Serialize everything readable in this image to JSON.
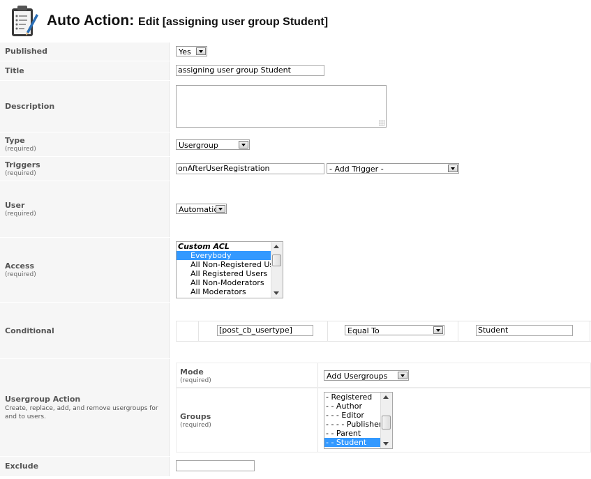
{
  "header": {
    "title": "Auto Action:",
    "subtitle": "Edit [assigning user group Student]",
    "icon": "clipboard-pencil-icon"
  },
  "fields": {
    "published": {
      "label": "Published",
      "value": "Yes"
    },
    "title": {
      "label": "Title",
      "value": "assigning user group Student"
    },
    "description": {
      "label": "Description",
      "value": ""
    },
    "type": {
      "label": "Type",
      "required": "(required)",
      "value": "Usergroup"
    },
    "triggers": {
      "label": "Triggers",
      "required": "(required)",
      "value": "onAfterUserRegistration",
      "add_trigger": "- Add Trigger -"
    },
    "user": {
      "label": "User",
      "required": "(required)",
      "value": "Automatic"
    },
    "access": {
      "label": "Access",
      "required": "(required)",
      "options": [
        {
          "text": "Custom ACL",
          "group": true
        },
        {
          "text": "Everybody",
          "selected": true
        },
        {
          "text": "All Non-Registered Users"
        },
        {
          "text": "All Registered Users"
        },
        {
          "text": "All Non-Moderators"
        },
        {
          "text": "All Moderators"
        }
      ]
    },
    "conditional": {
      "label": "Conditional",
      "field": "[post_cb_usertype]",
      "operator": "Equal To",
      "value": "Student"
    },
    "usergroup_action": {
      "label": "Usergroup Action",
      "description": "Create, replace, add, and remove usergroups for and to users.",
      "mode": {
        "label": "Mode",
        "required": "(required)",
        "value": "Add Usergroups"
      },
      "groups": {
        "label": "Groups",
        "required": "(required)",
        "options": [
          {
            "text": "- Registered"
          },
          {
            "text": "- - Author"
          },
          {
            "text": "- - - Editor"
          },
          {
            "text": "- - - - Publisher"
          },
          {
            "text": "- - Parent"
          },
          {
            "text": "- - Student",
            "selected": true
          }
        ]
      }
    },
    "exclude": {
      "label": "Exclude",
      "value": ""
    }
  },
  "colors": {
    "selection": "#3399ff",
    "label_bg": "#f6f6f6"
  }
}
